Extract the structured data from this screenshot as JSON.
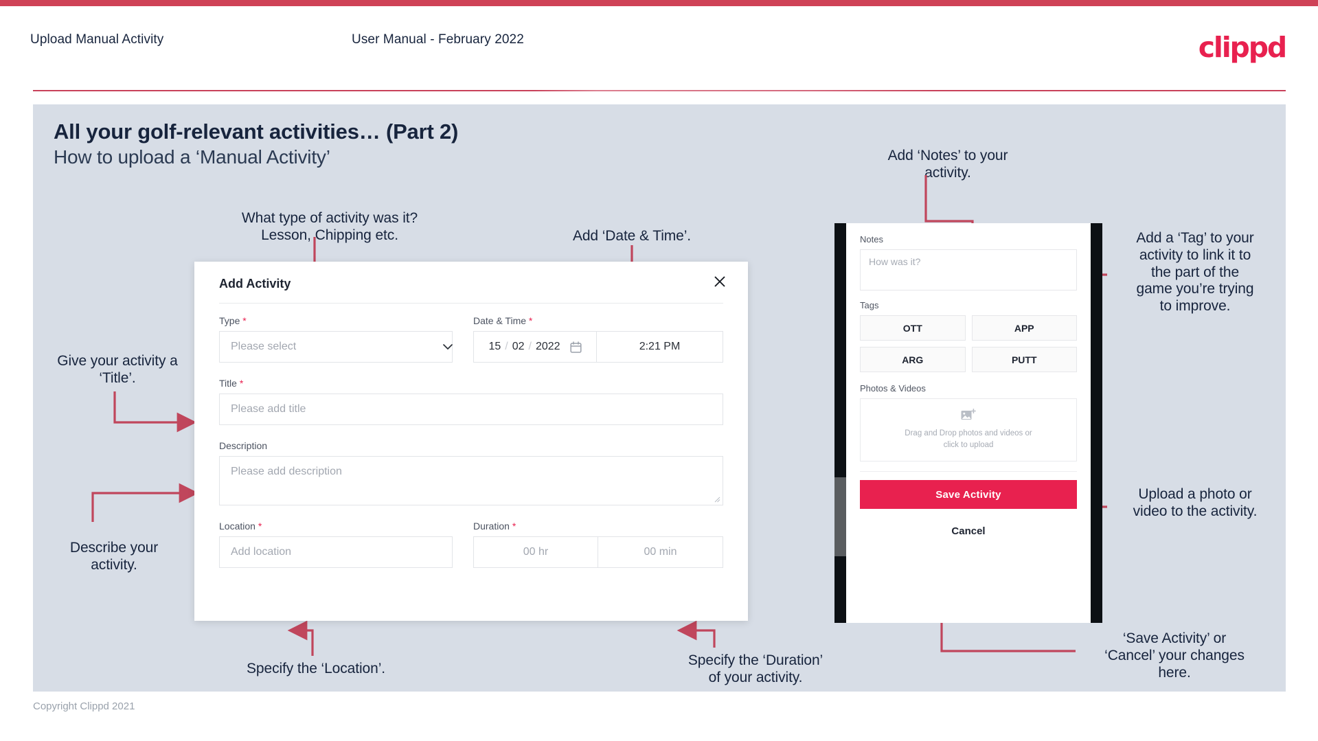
{
  "header": {
    "left_title": "Upload Manual Activity",
    "center_title": "User Manual - February 2022",
    "logo_text": "clippd"
  },
  "slide": {
    "heading": "All your golf-relevant activities… (Part 2)",
    "subheading": "How to upload a ‘Manual Activity’"
  },
  "footer": {
    "copyright": "Copyright Clippd 2021"
  },
  "annotations": {
    "type": "What type of activity was it?\nLesson, Chipping etc.",
    "datetime": "Add ‘Date & Time’.",
    "title": "Give your activity a\n‘Title’.",
    "description": "Describe your\nactivity.",
    "location": "Specify the ‘Location’.",
    "duration": "Specify the ‘Duration’\nof your activity.",
    "notes": "Add ‘Notes’ to your\nactivity.",
    "tags": "Add a ‘Tag’ to your\nactivity to link it to\nthe part of the\ngame you’re trying\nto improve.",
    "upload": "Upload a photo or\nvideo to the activity.",
    "save_cancel": "‘Save Activity’ or\n‘Cancel’ your changes\nhere."
  },
  "modal": {
    "title": "Add Activity",
    "close_icon": "close-icon",
    "fields": {
      "type_label": "Type",
      "type_placeholder": "Please select",
      "datetime_label": "Date & Time",
      "date_day": "15",
      "date_month": "02",
      "date_year": "2022",
      "date_sep": "/",
      "time_value": "2:21 PM",
      "title_label": "Title",
      "title_placeholder": "Please add title",
      "description_label": "Description",
      "description_placeholder": "Please add description",
      "location_label": "Location",
      "location_placeholder": "Add location",
      "duration_label": "Duration",
      "duration_hr_placeholder": "00 hr",
      "duration_min_placeholder": "00 min"
    },
    "required_mark": "*"
  },
  "phone": {
    "notes_label": "Notes",
    "notes_placeholder": "How was it?",
    "tags_label": "Tags",
    "tags": [
      "OTT",
      "APP",
      "ARG",
      "PUTT"
    ],
    "photos_label": "Photos & Videos",
    "dropzone_line1": "Drag and Drop photos and videos or",
    "dropzone_line2": "click to upload",
    "save_label": "Save Activity",
    "cancel_label": "Cancel"
  },
  "colors": {
    "brand_pink": "#e8214f",
    "top_bar": "#cf4257",
    "slide_bg": "#d7dde6",
    "ink": "#17243d",
    "arrow": "#c0465c"
  }
}
